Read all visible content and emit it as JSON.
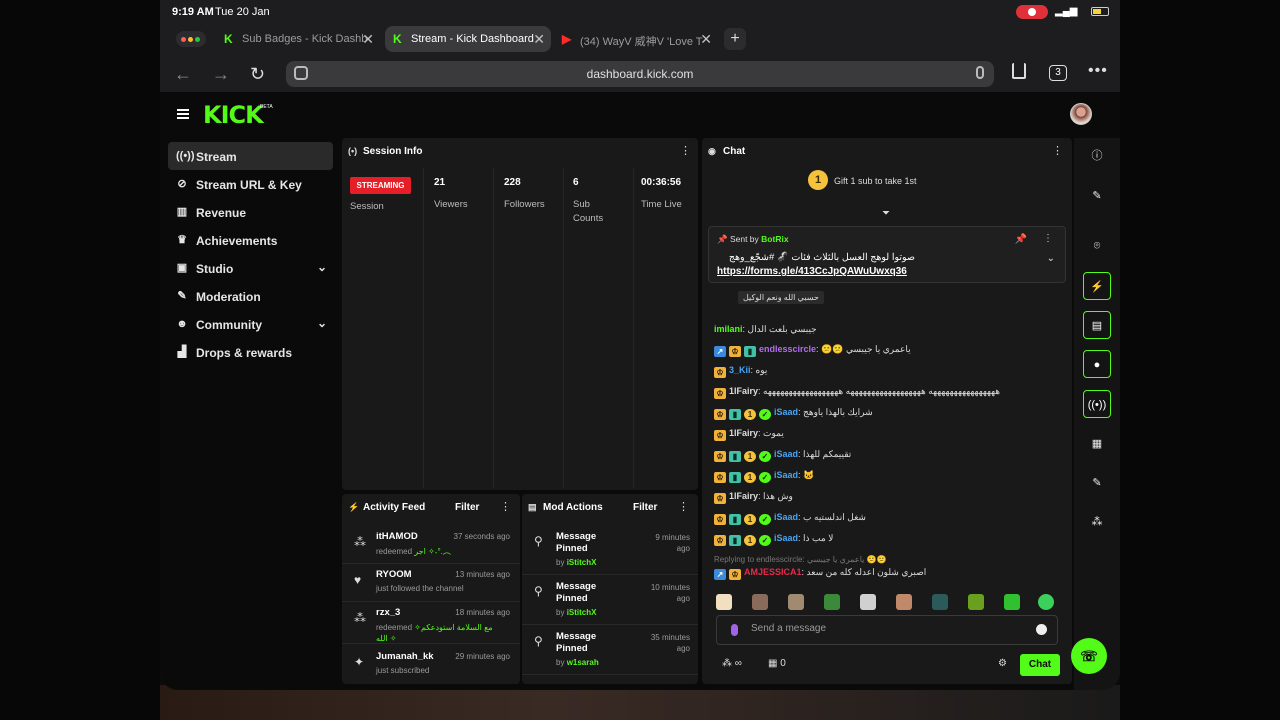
{
  "statusbar": {
    "time": "9:19 AM",
    "date": "Tue 20 Jan"
  },
  "browser": {
    "tabs": [
      {
        "label": "Sub Badges - Kick Dashb"
      },
      {
        "label": "Stream - Kick Dashboard"
      },
      {
        "label": "(34) WayV 威神V 'Love T"
      }
    ],
    "url": "dashboard.kick.com",
    "tab_count": "3"
  },
  "app": {
    "logo": "KICK",
    "logo_badge": "BETA"
  },
  "sidebar": {
    "items": [
      {
        "label": "Stream",
        "icon": "broadcast-icon"
      },
      {
        "label": "Stream URL & Key",
        "icon": "link-icon"
      },
      {
        "label": "Revenue",
        "icon": "chart-icon"
      },
      {
        "label": "Achievements",
        "icon": "trophy-icon"
      },
      {
        "label": "Studio",
        "icon": "studio-icon"
      },
      {
        "label": "Moderation",
        "icon": "wrench-icon"
      },
      {
        "label": "Community",
        "icon": "people-icon"
      },
      {
        "label": "Drops & rewards",
        "icon": "gift-icon"
      }
    ]
  },
  "session": {
    "title": "Session Info",
    "badge": "STREAMING",
    "session_label": "Session",
    "viewers": "21",
    "viewers_label": "Viewers",
    "followers": "228",
    "followers_label": "Followers",
    "subs": "6",
    "subs_label_1": "Sub",
    "subs_label_2": "Counts",
    "time": "00:36:56",
    "time_label": "Time Live"
  },
  "activity": {
    "title": "Activity Feed",
    "filter": "Filter",
    "items": [
      {
        "name": "itHAMOD",
        "when": "37 seconds ago",
        "action": "redeemed",
        "extra": "اجر ✧˖°.︵"
      },
      {
        "name": "RYOOM",
        "when": "13 minutes ago",
        "action": "just followed the channel",
        "extra": ""
      },
      {
        "name": "rzx_3",
        "when": "18 minutes ago",
        "action": "redeemed",
        "extra": "مع السلامة استودعكم✧ الله ✧"
      },
      {
        "name": "Jumanah_kk",
        "when": "29 minutes ago",
        "action": "just subscribed",
        "extra": ""
      }
    ]
  },
  "mod_actions": {
    "title": "Mod Actions",
    "filter": "Filter",
    "items": [
      {
        "title_1": "Message",
        "title_2": "Pinned",
        "when_1": "9 minutes",
        "when_2": "ago",
        "by": "by",
        "user": "iStitchX"
      },
      {
        "title_1": "Message",
        "title_2": "Pinned",
        "when_1": "10 minutes",
        "when_2": "ago",
        "by": "by",
        "user": "iStitchX"
      },
      {
        "title_1": "Message",
        "title_2": "Pinned",
        "when_1": "35 minutes",
        "when_2": "ago",
        "by": "by",
        "user": "w1sarah"
      }
    ]
  },
  "chat": {
    "title": "Chat",
    "gift_text": "Gift 1 sub to take 1st",
    "gift_rank": "1",
    "pinned": {
      "sent_by": "Sent by",
      "user": "BotRix",
      "message": "صوتوا لوهج العسل بالثلاث فئات 🦨 #شجّع_وهج",
      "link": "https://forms.gle/413CcJpQAWuUwxq36"
    },
    "tooltip": "حسبي الله ونعم الوكيل",
    "lines": [
      {
        "user": "imilani",
        "color": "#53fc18",
        "text": "جيبسي بلعت الدال"
      },
      {
        "user": "endlesscircle",
        "color": "#b36cf0",
        "text": "😕😕 ياعمري يا جيبسي"
      },
      {
        "user": "3_Kii",
        "color": "#4aa3f0",
        "text": "يوه"
      },
      {
        "user": "1lFairy",
        "color": "#ddd",
        "text": "ههههههههههههههههه ههههههههههههههههههه ههههههههههههههههههه"
      },
      {
        "user": "iSaad",
        "color": "#4aa3f0",
        "text": "شرايك بالهذا ياوهج"
      },
      {
        "user": "1lFairy",
        "color": "#ddd",
        "text": "يموت"
      },
      {
        "user": "iSaad",
        "color": "#4aa3f0",
        "text": "تقييمكم للهذا"
      },
      {
        "user": "iSaad",
        "color": "#4aa3f0",
        "text": "🐱"
      },
      {
        "user": "1lFairy",
        "color": "#ddd",
        "text": "وش هذا"
      },
      {
        "user": "iSaad",
        "color": "#4aa3f0",
        "text": "شغل اندلستيه ب"
      },
      {
        "user": "iSaad",
        "color": "#4aa3f0",
        "text": "لا مب ذا"
      },
      {
        "user": "AMJESSICA1",
        "color": "#e62a4a",
        "text": "اصبري شلون اعدله كله من سعد"
      }
    ],
    "reply_to": "Replying to endlesscircle: ياعمري يا جيبسي 😕😕",
    "placeholder": "Send a message",
    "points": "∞",
    "chest_count": "0",
    "send_label": "Chat"
  }
}
